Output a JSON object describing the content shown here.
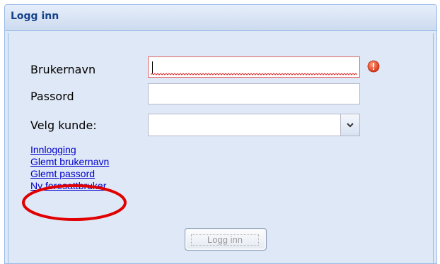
{
  "window": {
    "title": "Logg inn"
  },
  "form": {
    "username_label": "Brukernavn",
    "username_value": "",
    "password_label": "Passord",
    "password_value": "",
    "customer_label": "Velg kunde:",
    "customer_value": ""
  },
  "links": {
    "login": "Innlogging",
    "forgot_username": "Glemt brukernavn",
    "forgot_password": "Glemt passord",
    "new_parent_user": "Ny foresattbruker"
  },
  "buttons": {
    "login": "Logg inn"
  },
  "icons": {
    "error": "error-icon",
    "dropdown": "chevron-down-icon"
  },
  "colors": {
    "header_text": "#15428b",
    "panel_bg": "#dfe8f6",
    "link": "#0000cc",
    "error_border": "#dd6666",
    "highlight_oval": "#e00000"
  }
}
